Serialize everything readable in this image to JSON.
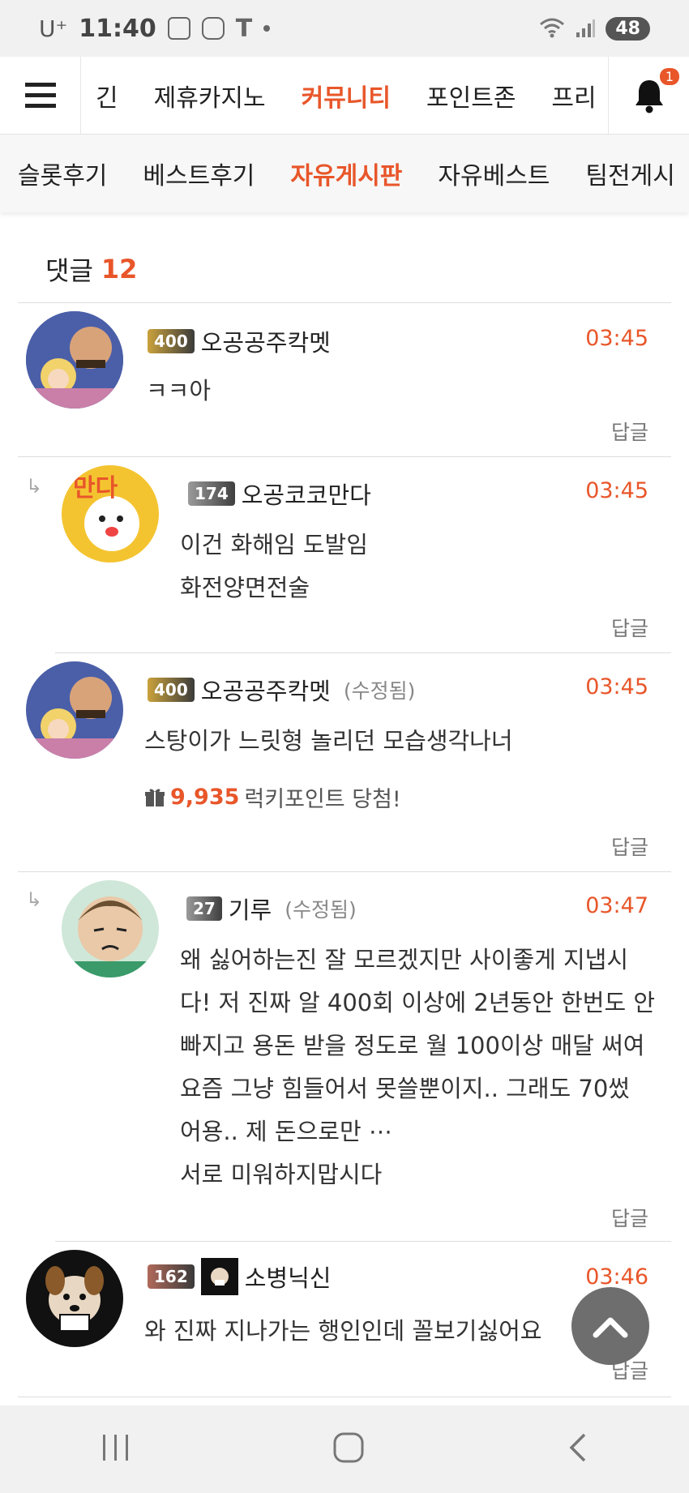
{
  "status_bar": {
    "carrier": "U⁺",
    "time": "11:40",
    "battery": "48"
  },
  "top_nav": {
    "items": [
      "긴",
      "제휴카지노",
      "커뮤니티",
      "포인트존",
      "프리"
    ],
    "active": "커뮤니티",
    "notification_count": "1"
  },
  "sub_nav": {
    "items": [
      "슬롯후기",
      "베스트후기",
      "자유게시판",
      "자유베스트",
      "팀전게시"
    ],
    "active": "자유게시판"
  },
  "comments_header": {
    "label": "댓글",
    "count": "12"
  },
  "comments": [
    {
      "level": "400",
      "nick": "오공공주칵멧",
      "time": "03:45",
      "lines": [
        "ㅋㅋ아"
      ],
      "reply_label": "답글"
    },
    {
      "level": "174",
      "nick": "오공코코만다",
      "time": "03:45",
      "lines": [
        "이건 화해임 도발임",
        "화전양면전술"
      ],
      "reply_label": "답글"
    },
    {
      "level": "400",
      "nick": "오공공주칵멧",
      "edited": "(수정됨)",
      "time": "03:45",
      "lines": [
        "스탕이가 느릿형 놀리던 모습생각나너"
      ],
      "lucky_points": "9,935",
      "lucky_text": "럭키포인트 당첨!",
      "reply_label": "답글"
    },
    {
      "level": "27",
      "nick": "기루",
      "edited": "(수정됨)",
      "time": "03:47",
      "lines": [
        "왜 싫어하는진 잘 모르겠지만 사이좋게 지냅시",
        "다! 저 진짜 알 400회 이상에 2년동안 한번도 안",
        "빠지고 용돈 받을 정도로 월 100이상 매달 써여",
        "요즘 그냥 힘들어서 못쓸뿐이지.. 그래도 70썼",
        "어용.. 제 돈으로만 ⋯",
        "서로 미워하지맙시다"
      ],
      "reply_label": "답글"
    },
    {
      "level": "162",
      "nick": "소병닉신",
      "time": "03:46",
      "lines": [
        "와 진짜 지나가는 행인인데 꼴보기싫어요"
      ],
      "reply_label": "답글"
    }
  ],
  "colors": {
    "accent": "#e8562a"
  }
}
